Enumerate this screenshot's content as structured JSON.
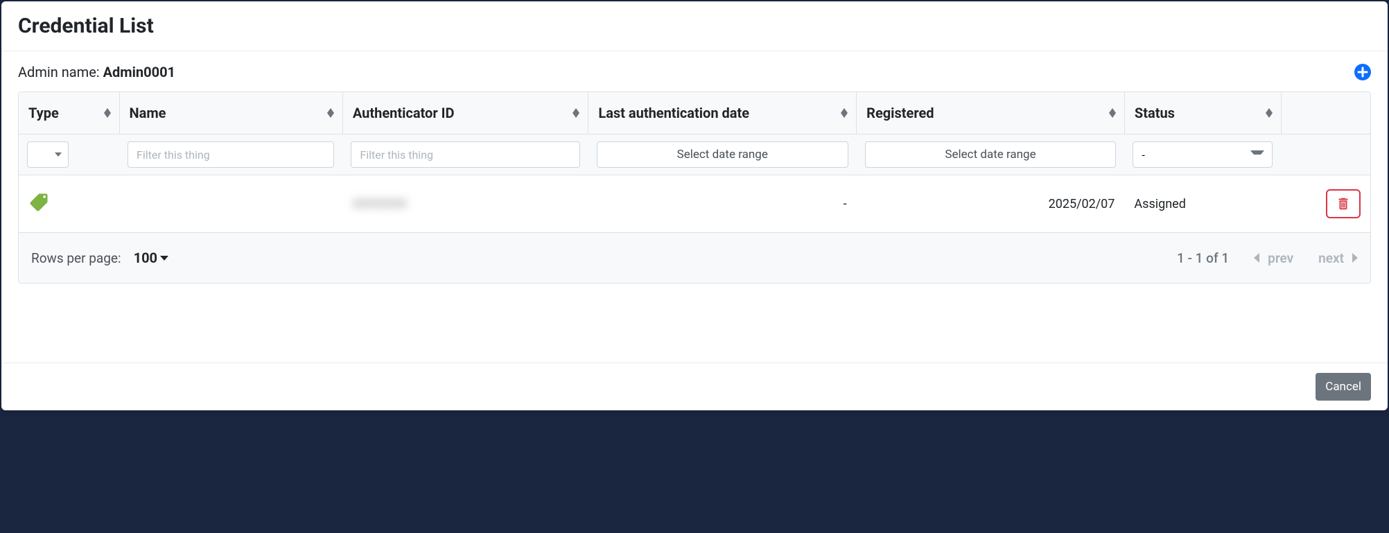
{
  "modal": {
    "title": "Credential List",
    "admin_label": "Admin name: ",
    "admin_name": "Admin0001"
  },
  "table": {
    "headers": {
      "type": "Type",
      "name": "Name",
      "authenticator_id": "Authenticator ID",
      "last_auth_date": "Last authentication date",
      "registered": "Registered",
      "status": "Status"
    },
    "filters": {
      "name_placeholder": "Filter this thing",
      "auth_placeholder": "Filter this thing",
      "date_placeholder": "Select date range",
      "status_value": "-"
    },
    "rows": [
      {
        "type_icon": "tag-icon",
        "name": "",
        "authenticator_id": "XXXXXXX",
        "last_auth_date": "-",
        "registered": "2025/02/07",
        "status": "Assigned"
      }
    ]
  },
  "pagination": {
    "rows_per_page_label": "Rows per page:",
    "rows_per_page_value": "100",
    "page_info": "1 - 1 of 1",
    "prev_label": "prev",
    "next_label": "next"
  },
  "footer": {
    "cancel_label": "Cancel"
  }
}
